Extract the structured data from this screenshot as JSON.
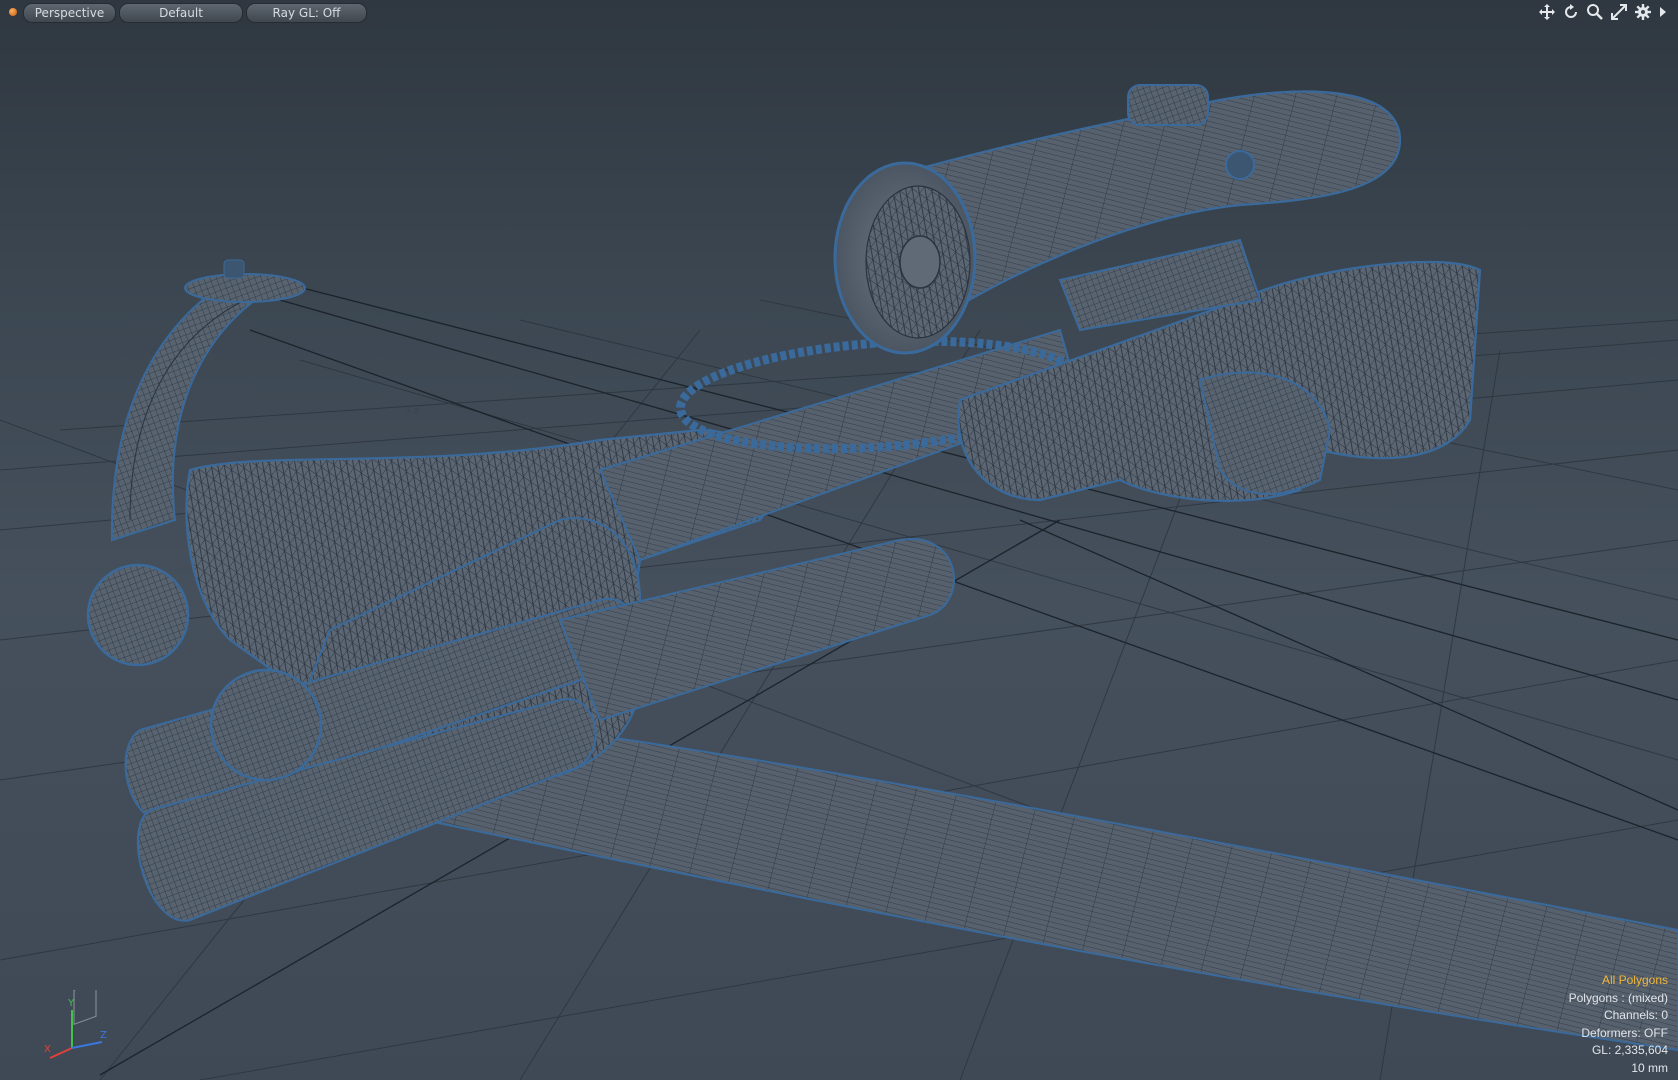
{
  "toolbar": {
    "view_label": "Perspective",
    "style_label": "Default",
    "raygl_label": "Ray GL: Off",
    "icons": [
      "move-icon",
      "rotate-icon",
      "zoom-icon",
      "fit-icon",
      "gear-icon",
      "arrow-right-icon"
    ]
  },
  "info": {
    "selection": "All Polygons",
    "polygons": "Polygons : (mixed)",
    "channels": "Channels: 0",
    "deformers": "Deformers: OFF",
    "gl": "GL: 2,335,604",
    "unit": "10 mm"
  },
  "axes": {
    "x": "X",
    "y": "Y",
    "z": "Z"
  },
  "colors": {
    "accent": "#f2b63a",
    "wire": "#1e2a36",
    "mesh_edge": "#3a6a9c",
    "mesh_fill": "#5a6470"
  }
}
